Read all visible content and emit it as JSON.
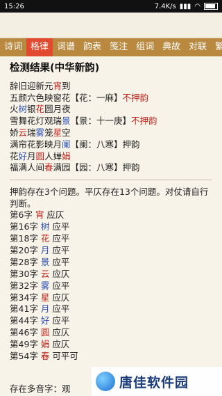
{
  "status": {
    "time": "15:26",
    "speed": "7.4K/s"
  },
  "tabs": [
    "诗词",
    "格律",
    "词谱",
    "韵表",
    "笺注",
    "组词",
    "典故",
    "对联",
    "繁简"
  ],
  "active_tab_index": 1,
  "result_title": "检测结果(中华新韵)",
  "poem_lines": [
    [
      {
        "t": "辞旧迎新元"
      },
      {
        "t": "宵",
        "c": "red"
      },
      {
        "t": "到"
      }
    ],
    [
      {
        "t": "五颜六色映窗花【花：一麻】"
      },
      {
        "t": "不押韵",
        "c": "red"
      }
    ],
    [
      {
        "t": "火"
      },
      {
        "t": "树",
        "c": "blue"
      },
      {
        "t": "银"
      },
      {
        "t": "花",
        "c": "red"
      },
      {
        "t": "圆月夜"
      }
    ],
    [
      {
        "t": "雪舞花灯观瑞"
      },
      {
        "t": "景",
        "c": "blue"
      },
      {
        "t": "【景：十一庚】"
      },
      {
        "t": "不押韵",
        "c": "red"
      }
    ],
    [
      {
        "t": "娇"
      },
      {
        "t": "云",
        "c": "red"
      },
      {
        "t": "瑞"
      },
      {
        "t": "雾",
        "c": "blue"
      },
      {
        "t": "笼"
      },
      {
        "t": "星",
        "c": "red"
      },
      {
        "t": "空"
      }
    ],
    [
      {
        "t": "满帘花影映月"
      },
      {
        "t": "阑",
        "c": "blue"
      },
      {
        "t": "【阑：八寒】押韵"
      }
    ],
    [
      {
        "t": "花"
      },
      {
        "t": "好",
        "c": "blue"
      },
      {
        "t": "月"
      },
      {
        "t": "圆",
        "c": "red"
      },
      {
        "t": "人婵"
      },
      {
        "t": "娟",
        "c": "red"
      }
    ],
    [
      {
        "t": "福满人间"
      },
      {
        "t": "春",
        "c": "red"
      },
      {
        "t": "满园【园：八寒】押韵"
      }
    ]
  ],
  "summary": "押韵存在3个问题。平仄存在13个问题。对仗请自行判断。",
  "char_issues": [
    {
      "pos": "第6字",
      "ch": "宵",
      "c": "red",
      "req": "应仄"
    },
    {
      "pos": "第16字",
      "ch": "树",
      "c": "blue",
      "req": "应平"
    },
    {
      "pos": "第18字",
      "ch": "花",
      "c": "red",
      "req": "应平"
    },
    {
      "pos": "第20字",
      "ch": "月",
      "c": "blue",
      "req": "应平"
    },
    {
      "pos": "第28字",
      "ch": "景",
      "c": "blue",
      "req": "应平"
    },
    {
      "pos": "第30字",
      "ch": "云",
      "c": "red",
      "req": "应仄"
    },
    {
      "pos": "第32字",
      "ch": "雾",
      "c": "blue",
      "req": "应平"
    },
    {
      "pos": "第34字",
      "ch": "星",
      "c": "red",
      "req": "应仄"
    },
    {
      "pos": "第41字",
      "ch": "月",
      "c": "blue",
      "req": "应平"
    },
    {
      "pos": "第44字",
      "ch": "好",
      "c": "blue",
      "req": "应平"
    },
    {
      "pos": "第46字",
      "ch": "圆",
      "c": "red",
      "req": "应仄"
    },
    {
      "pos": "第49字",
      "ch": "娟",
      "c": "red",
      "req": "应仄"
    },
    {
      "pos": "第54字",
      "ch": "春",
      "c": "red",
      "req": "可平可"
    }
  ],
  "multi_sound": "存在多音字：观",
  "watermark_text": "唐佳软件园"
}
